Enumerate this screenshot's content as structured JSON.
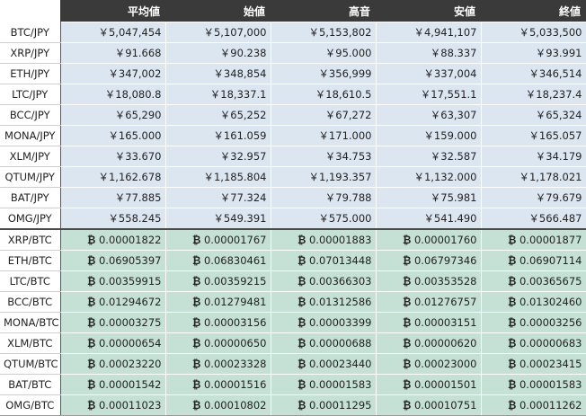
{
  "headers": [
    "",
    "平均値",
    "始値",
    "高音",
    "安値",
    "終値"
  ],
  "jpy_rows": [
    {
      "pair": "BTC/JPY",
      "values": [
        "￥5,047,454",
        "￥5,107,000",
        "￥5,153,802",
        "￥4,941,107",
        "￥5,033,500"
      ]
    },
    {
      "pair": "XRP/JPY",
      "values": [
        "￥91.668",
        "￥90.238",
        "￥95.000",
        "￥88.337",
        "￥93.991"
      ]
    },
    {
      "pair": "ETH/JPY",
      "values": [
        "￥347,002",
        "￥348,854",
        "￥356,999",
        "￥337,004",
        "￥346,514"
      ]
    },
    {
      "pair": "LTC/JPY",
      "values": [
        "￥18,080.8",
        "￥18,337.1",
        "￥18,610.5",
        "￥17,551.1",
        "￥18,237.4"
      ]
    },
    {
      "pair": "BCC/JPY",
      "values": [
        "￥65,290",
        "￥65,252",
        "￥67,272",
        "￥63,307",
        "￥65,324"
      ]
    },
    {
      "pair": "MONA/JPY",
      "values": [
        "￥165.000",
        "￥161.059",
        "￥171.000",
        "￥159.000",
        "￥165.057"
      ]
    },
    {
      "pair": "XLM/JPY",
      "values": [
        "￥33.670",
        "￥32.957",
        "￥34.753",
        "￥32.587",
        "￥34.179"
      ]
    },
    {
      "pair": "QTUM/JPY",
      "values": [
        "￥1,162.678",
        "￥1,185.804",
        "￥1,193.357",
        "￥1,132.000",
        "￥1,178.021"
      ]
    },
    {
      "pair": "BAT/JPY",
      "values": [
        "￥77.885",
        "￥77.324",
        "￥79.788",
        "￥75.981",
        "￥79.679"
      ]
    },
    {
      "pair": "OMG/JPY",
      "values": [
        "￥558.245",
        "￥549.391",
        "￥575.000",
        "￥541.490",
        "￥566.487"
      ]
    }
  ],
  "btc_sign": "₿",
  "btc_rows": [
    {
      "pair": "XRP/BTC",
      "values": [
        "0.00001822",
        "0.00001767",
        "0.00001883",
        "0.00001760",
        "0.00001877"
      ]
    },
    {
      "pair": "ETH/BTC",
      "values": [
        "0.06905397",
        "0.06830461",
        "0.07013448",
        "0.06797346",
        "0.06907114"
      ]
    },
    {
      "pair": "LTC/BTC",
      "values": [
        "0.00359915",
        "0.00359215",
        "0.00366303",
        "0.00353528",
        "0.00365675"
      ]
    },
    {
      "pair": "BCC/BTC",
      "values": [
        "0.01294672",
        "0.01279481",
        "0.01312586",
        "0.01276757",
        "0.01302460"
      ]
    },
    {
      "pair": "MONA/BTC",
      "values": [
        "0.00003275",
        "0.00003156",
        "0.00003399",
        "0.00003151",
        "0.00003256"
      ]
    },
    {
      "pair": "XLM/BTC",
      "values": [
        "0.00000654",
        "0.00000650",
        "0.00000688",
        "0.00000620",
        "0.00000683"
      ]
    },
    {
      "pair": "QTUM/BTC",
      "values": [
        "0.00023220",
        "0.00023328",
        "0.00023440",
        "0.00023000",
        "0.00023415"
      ]
    },
    {
      "pair": "BAT/BTC",
      "values": [
        "0.00001542",
        "0.00001516",
        "0.00001583",
        "0.00001501",
        "0.00001583"
      ]
    },
    {
      "pair": "OMG/BTC",
      "values": [
        "0.00011023",
        "0.00010802",
        "0.00011295",
        "0.00010751",
        "0.00011262"
      ]
    }
  ],
  "colors": {
    "header_bg": "#3a3a3a",
    "jpy_row_bg": "#dce6f1",
    "btc_row_bg": "#c5e0d5"
  }
}
